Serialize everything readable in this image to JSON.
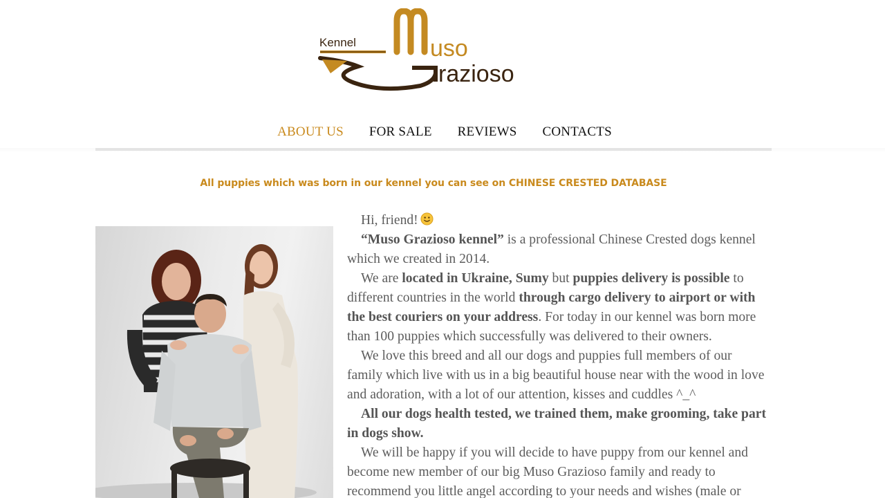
{
  "logo": {
    "kennel": "Kennel",
    "line1": "uso",
    "line2": "razioso",
    "alt": "Kennel Muso Grazioso"
  },
  "nav": {
    "items": [
      {
        "label": "ABOUT US",
        "active": true
      },
      {
        "label": "FOR SALE",
        "active": false
      },
      {
        "label": "REVIEWS",
        "active": false
      },
      {
        "label": "CONTACTS",
        "active": false
      }
    ]
  },
  "notice": {
    "text": "All puppies which was born in our kennel you can see on CHINESE CRESTED DATABASE"
  },
  "photo": {
    "alt": "Family portrait of the kennel owners"
  },
  "article": {
    "greeting": "Hi, friend!",
    "p1_bold": "“Muso Grazioso kennel”",
    "p1_rest": " is a professional Chinese Crested dogs kennel which we created in 2014.",
    "p2_a": "We are ",
    "p2_b1": "located in Ukraine, Sumy",
    "p2_c": " but ",
    "p2_b2": "puppies delivery is possible",
    "p2_d": " to different countries in the world ",
    "p2_b3": "through cargo delivery to airport or with the best couriers on your address",
    "p2_e": ". For today in our kennel was born more than 100 puppies which successfully was delivered to their owners.",
    "p3": "We love this breed and all our dogs and puppies full members of our family which live with us in a big beautiful house near with the wood in love and adoration, with a lot of our attention, kisses and cuddles ^_^",
    "p4_bold": "All our dogs health tested, we trained them, make grooming, take part in dogs show.",
    "p5": "We will be happy if you will decide to have puppy from our kennel and become new member of our big Muso Grazioso family and ready to recommend you little angel according to your needs and wishes (male or"
  },
  "colors": {
    "accent": "#c98a1d",
    "logo_brown": "#3a2410",
    "text": "#5c5c5c",
    "nav_text": "#111111"
  }
}
